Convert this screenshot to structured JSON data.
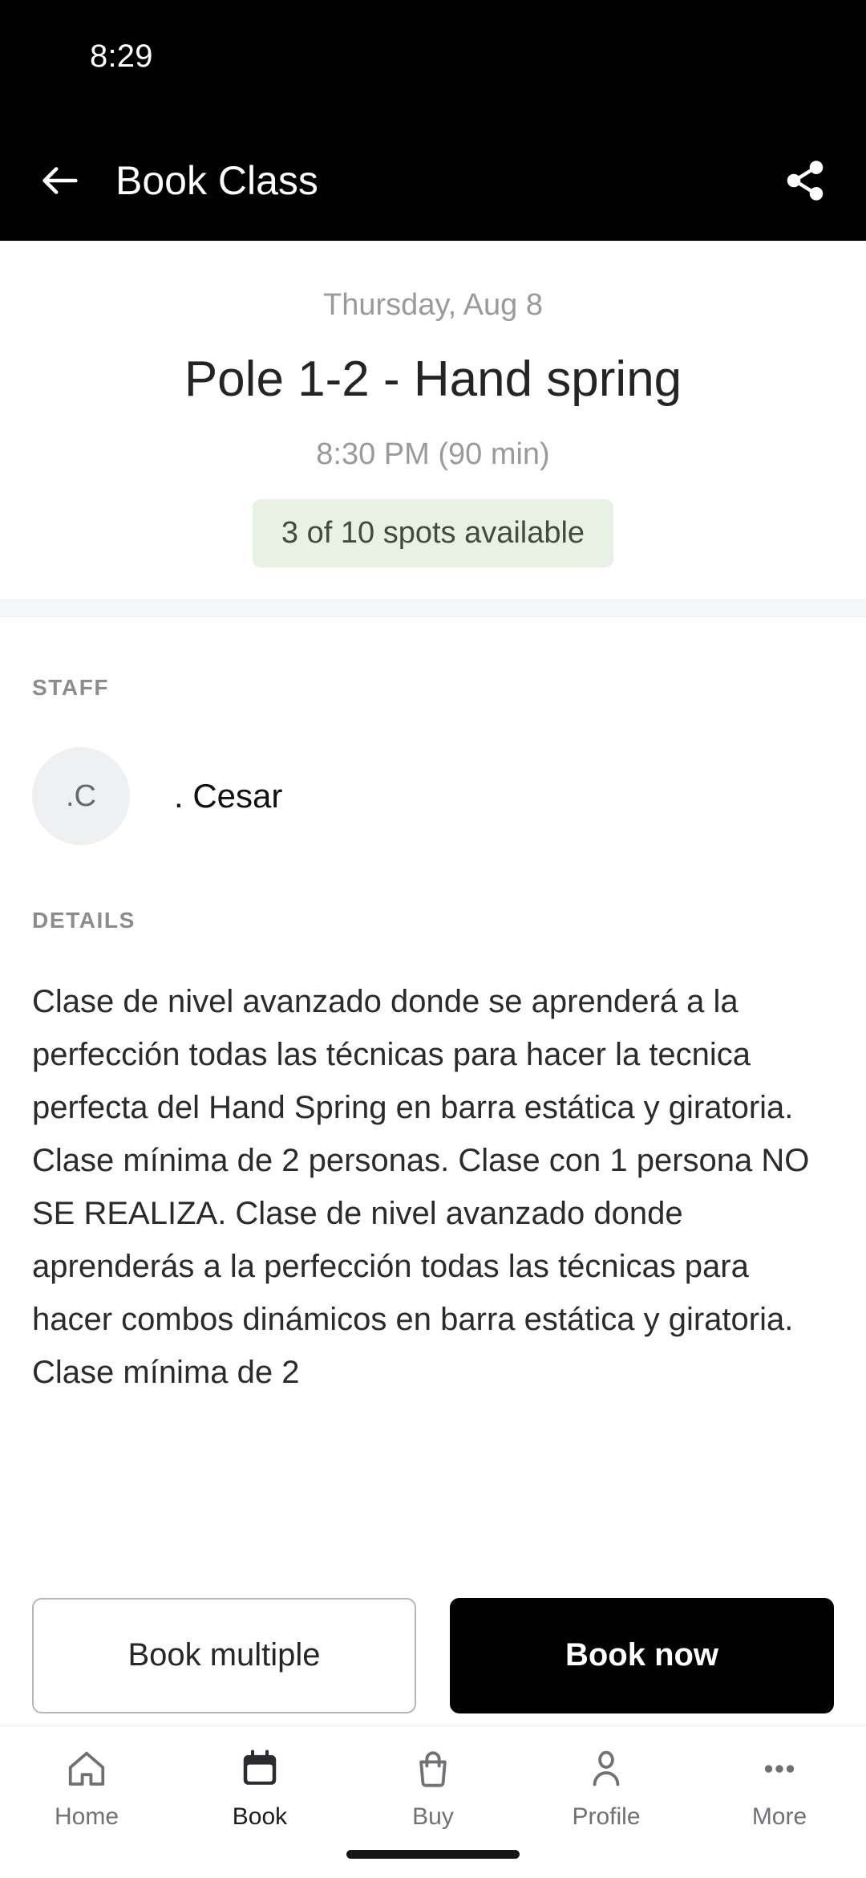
{
  "status_bar": {
    "time": "8:29"
  },
  "app_bar": {
    "back_label": "back-arrow",
    "title": "Book Class",
    "share_label": "share"
  },
  "hero": {
    "date": "Thursday, Aug 8",
    "class_title": "Pole 1-2 - Hand spring",
    "time_duration": "8:30 PM (90 min)",
    "spots_badge": "3 of 10 spots available",
    "badge_bg_color": "#e7f2e4",
    "badge_text_color": "#414b41"
  },
  "staff_section": {
    "label": "STAFF",
    "avatar_initials": ".C",
    "name": ". Cesar"
  },
  "details_section": {
    "label": "DETAILS",
    "text": "Clase de nivel avanzado donde se aprenderá a la perfección todas las técnicas para hacer la tecnica perfecta del Hand Spring en barra estática y giratoria. Clase mínima de 2 personas. Clase con 1 persona NO SE REALIZA. Clase de nivel avanzado donde aprenderás a la perfección todas las técnicas para hacer combos dinámicos en barra estática y giratoria. Clase mínima de 2"
  },
  "actions": {
    "secondary_label": "Book multiple",
    "primary_label": "Book now",
    "primary_bg_color": "#000000"
  },
  "bottom_nav": {
    "items": [
      {
        "label": "Home",
        "icon": "home-icon",
        "active": false
      },
      {
        "label": "Book",
        "icon": "calendar-icon",
        "active": true
      },
      {
        "label": "Buy",
        "icon": "shopping-bag-icon",
        "active": false
      },
      {
        "label": "Profile",
        "icon": "person-icon",
        "active": false
      },
      {
        "label": "More",
        "icon": "more-dots-icon",
        "active": false
      }
    ]
  }
}
